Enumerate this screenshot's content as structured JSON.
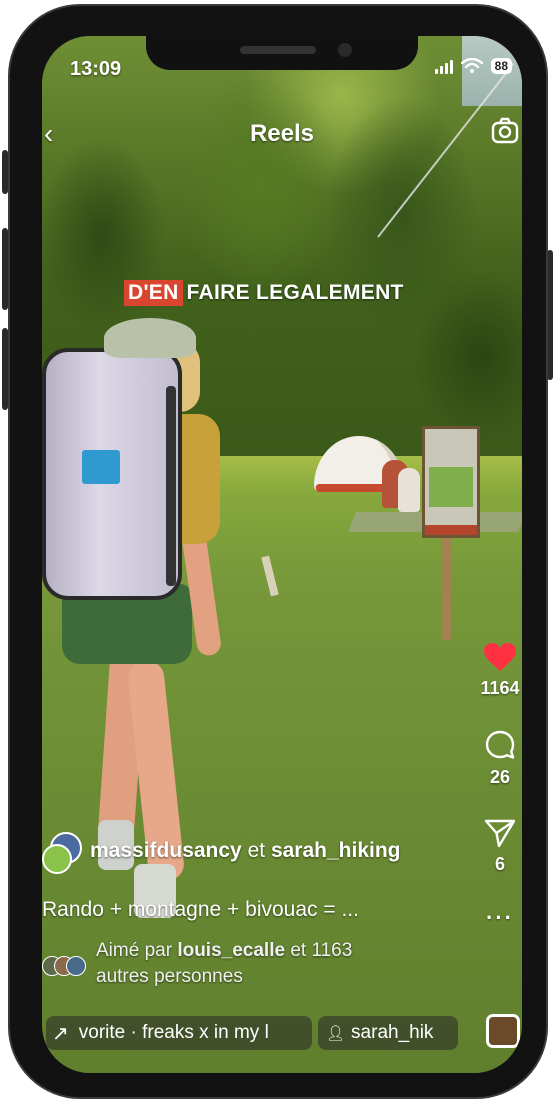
{
  "status_bar": {
    "time": "13:09",
    "battery": "88"
  },
  "header": {
    "title": "Reels"
  },
  "video": {
    "caption_highlight": "D'EN",
    "caption_rest": "FAIRE LEGALEMENT"
  },
  "actions": {
    "likes": "1164",
    "comments": "26",
    "shares": "6"
  },
  "post": {
    "authors_1": "massifdusancy",
    "authors_sep": " et ",
    "authors_2": "sarah_hiking",
    "description": "Rando + montagne + bivouac = ...",
    "liked_prefix": "Aimé par ",
    "liked_user": "louis_ecalle",
    "liked_suffix": " et 1163",
    "liked_line2": "autres personnes"
  },
  "bottom": {
    "audio": "vorite · freaks x in my l",
    "tag": "sarah_hik"
  },
  "colors": {
    "like": "#ff3040",
    "caption_highlight": "#d9452f"
  }
}
